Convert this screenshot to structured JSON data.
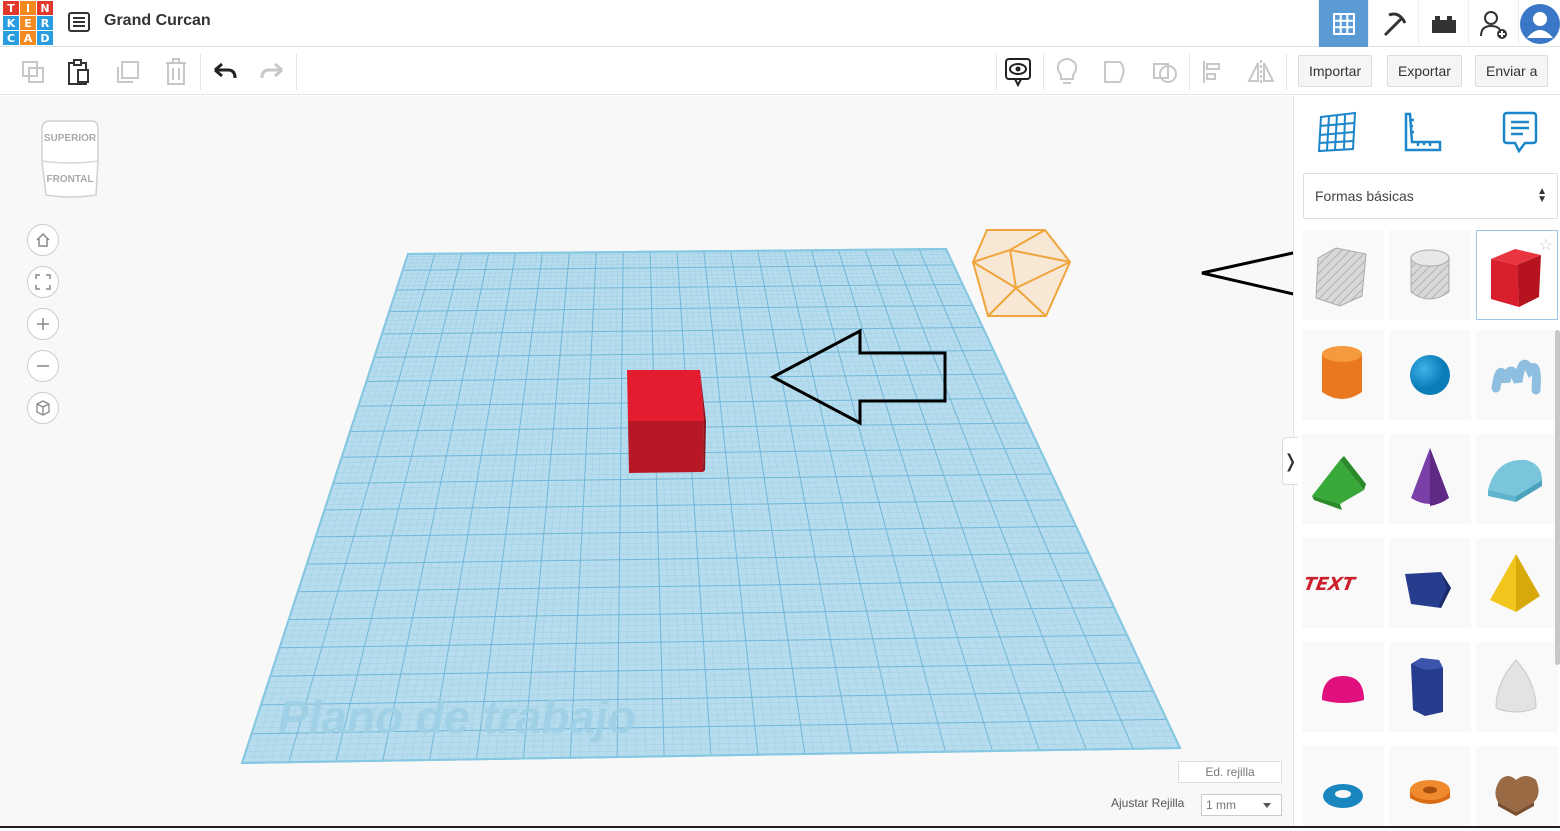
{
  "app": {
    "logo_letters": [
      "T",
      "I",
      "N",
      "K",
      "E",
      "R",
      "C",
      "A",
      "D"
    ],
    "logo_colors": [
      "#e2372b",
      "#f48a1f",
      "#e2372b",
      "#2a9de0",
      "#f48a1f",
      "#2a9de0",
      "#2a9de0",
      "#f48a1f",
      "#2a9de0"
    ],
    "design_title": "Grand Curcan"
  },
  "header": {
    "icons": [
      "3d-design-icon",
      "pickaxe-icon",
      "bricks-icon",
      "add-user-icon",
      "avatar-icon"
    ]
  },
  "toolbar": {
    "import_label": "Importar",
    "export_label": "Exportar",
    "send_label": "Enviar a"
  },
  "viewcube": {
    "top_label": "SUPERIOR",
    "front_label": "FRONTAL"
  },
  "workplane": {
    "label": "Plano de trabajo"
  },
  "grid_controls": {
    "edit_label": "Ed. rejilla",
    "snap_label": "Ajustar Rejilla",
    "snap_value": "1 mm"
  },
  "panel": {
    "category": "Formas básicas",
    "shapes": [
      "caja-hueco",
      "cilindro-hueco",
      "caja",
      "cilindro",
      "esfera",
      "garabato",
      "techo",
      "cono",
      "techo-redondo",
      "texto",
      "prisma",
      "piramide",
      "media-esfera",
      "poligono",
      "paraboloide",
      "toroide",
      "tubo",
      "corazon"
    ]
  },
  "colors": {
    "accent": "#5b9bd5",
    "workplane": "#aad7ea",
    "box_red": "#d42230"
  }
}
